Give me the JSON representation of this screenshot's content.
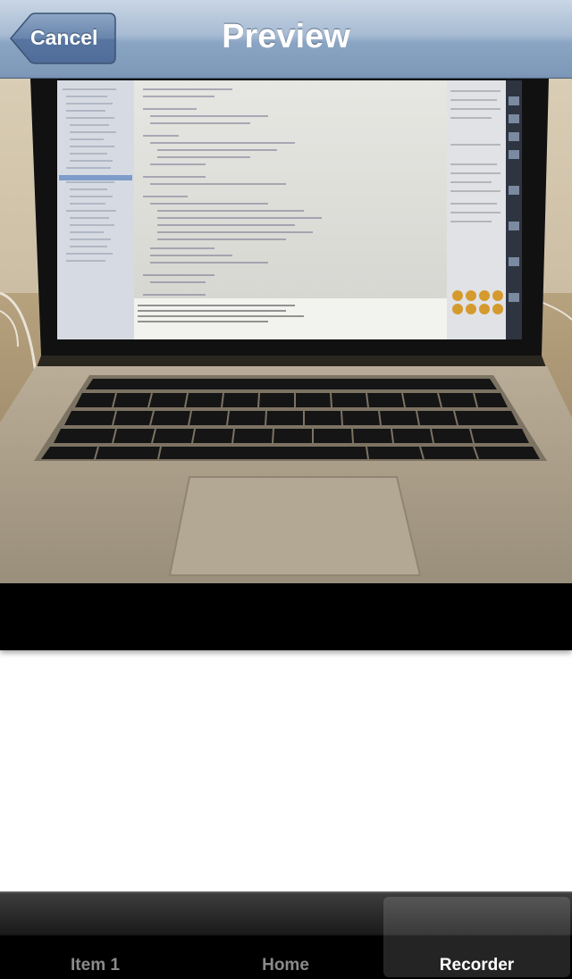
{
  "navbar": {
    "title": "Preview",
    "back_label": "Cancel"
  },
  "preview": {
    "image_subject": "laptop-photo"
  },
  "tabbar": {
    "tabs": [
      {
        "label": "Item 1",
        "selected": false
      },
      {
        "label": "Home",
        "selected": false
      },
      {
        "label": "Recorder",
        "selected": true
      }
    ]
  },
  "colors": {
    "navbar": "#8aa4c3",
    "tabbar": "#000000",
    "selected_tab_text": "#ffffff",
    "unselected_tab_text": "#8a8a8a"
  }
}
